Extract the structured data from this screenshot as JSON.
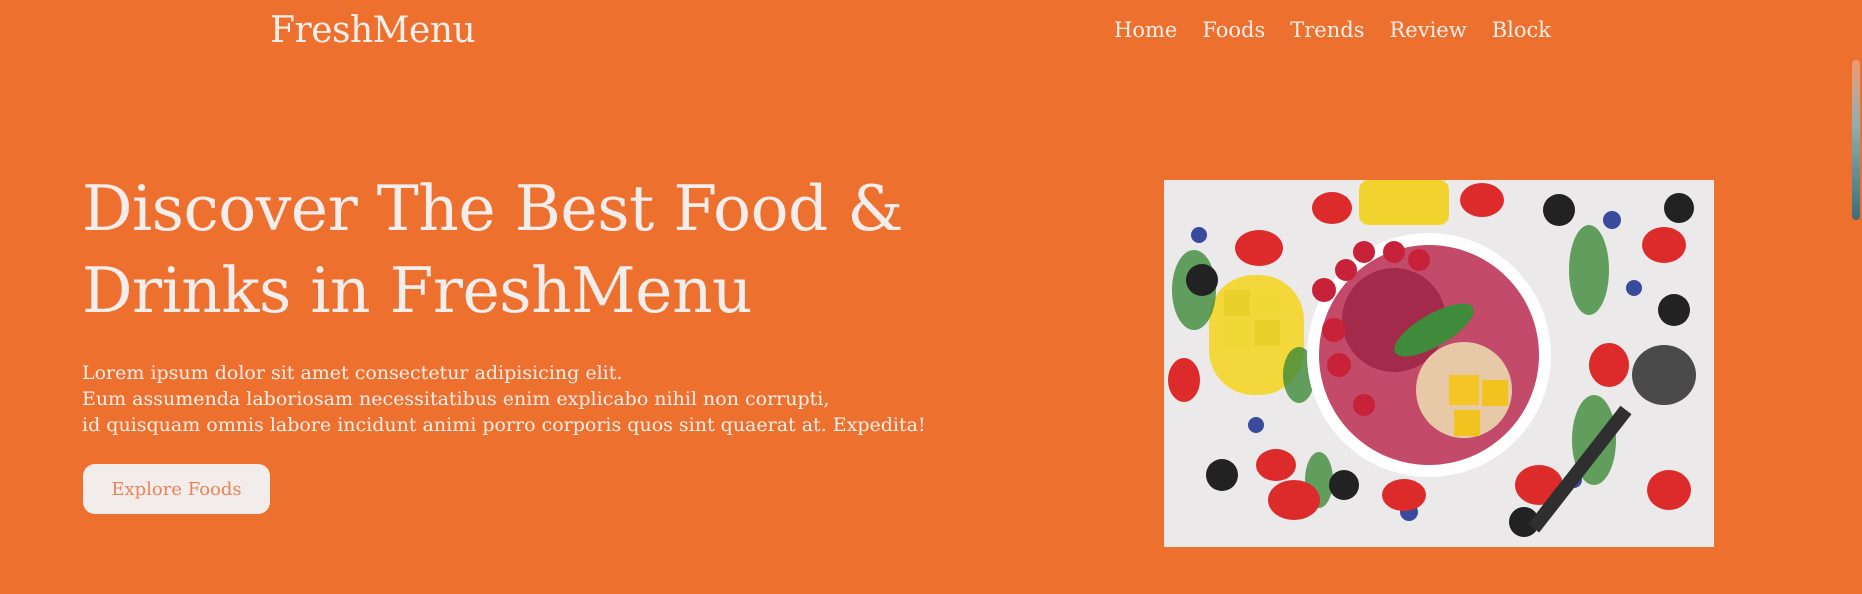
{
  "brand": {
    "name": "FreshMenu"
  },
  "nav": {
    "items": [
      "Home",
      "Foods",
      "Trends",
      "Review",
      "Block"
    ]
  },
  "hero": {
    "title": "Discover The Best Food & Drinks in FreshMenu",
    "description_lines": [
      "Lorem ipsum dolor sit amet consectetur adipisicing elit.",
      "Eum assumenda laboriosam necessitatibus enim explicabo nihil non corrupti,",
      "id quisquam omnis labore incidunt animi porro corporis quos sint quaerat at. Expedita!"
    ],
    "cta_label": "Explore Foods"
  },
  "colors": {
    "background": "#ee702f",
    "text": "#f4eee9",
    "button_bg": "#f2ecea",
    "button_text": "#e6845a"
  },
  "icons": {
    "hero_image": "fruit-bowl-photo"
  }
}
